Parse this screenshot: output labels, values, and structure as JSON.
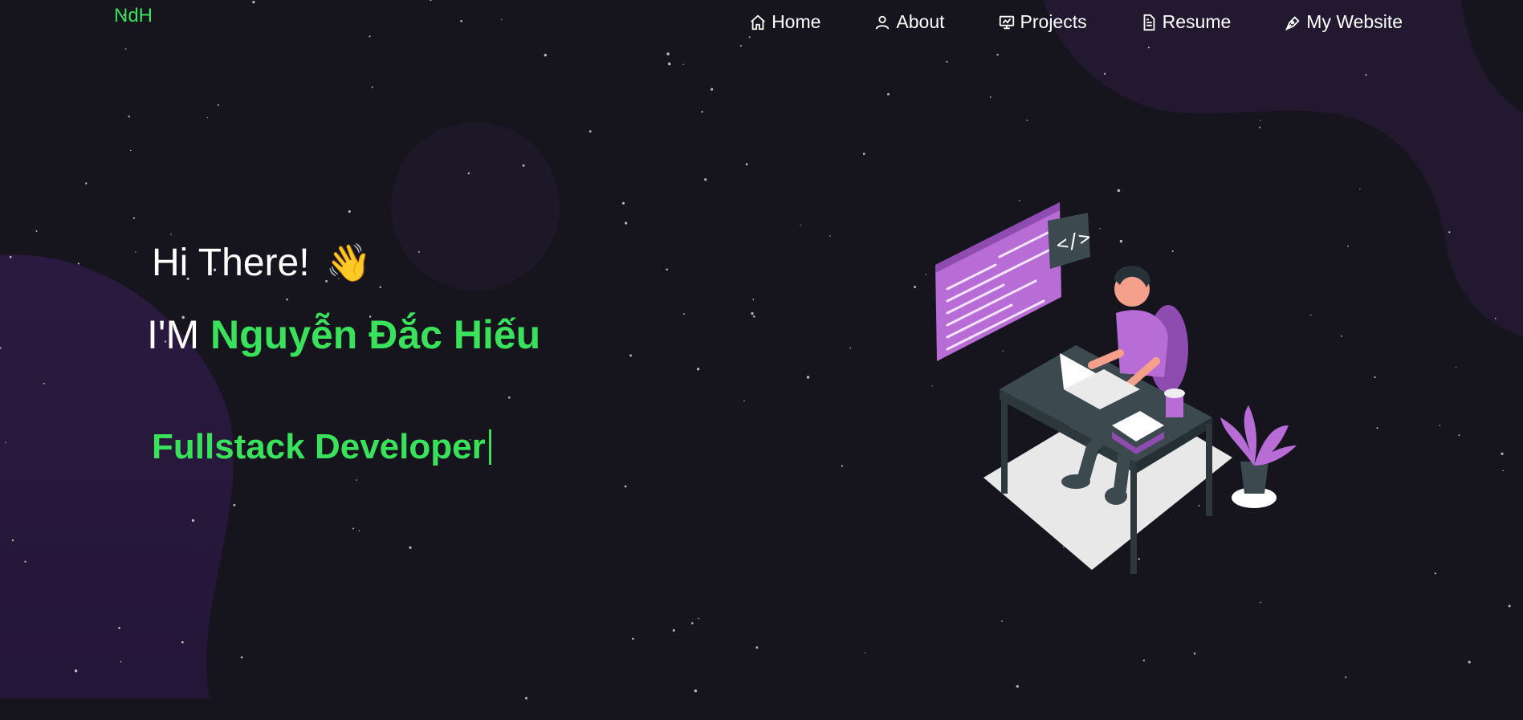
{
  "brand": {
    "logo_text": "NdH"
  },
  "nav": {
    "items": [
      {
        "label": "Home",
        "icon": "home-icon"
      },
      {
        "label": "About",
        "icon": "user-icon"
      },
      {
        "label": "Projects",
        "icon": "projects-icon"
      },
      {
        "label": "Resume",
        "icon": "document-icon"
      },
      {
        "label": "My Website",
        "icon": "pen-icon"
      }
    ]
  },
  "hero": {
    "greeting": "Hi There!",
    "wave_emoji": "👋",
    "intro_prefix": "I'M",
    "name": "Nguyễn Đắc Hiếu",
    "role": "Fullstack Developer"
  },
  "colors": {
    "background": "#16141d",
    "accent": "#39e25a",
    "text": "#ffffff",
    "blob": "#2a1b3e",
    "illustration_purple": "#b86cd6"
  }
}
